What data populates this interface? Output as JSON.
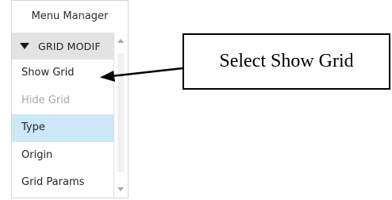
{
  "menu_manager": {
    "title": "Menu Manager",
    "group": {
      "label": "GRID MODIF",
      "expanded_icon": "triangle-down-icon"
    },
    "items": [
      {
        "label": "Show Grid",
        "state": "normal"
      },
      {
        "label": "Hide Grid",
        "state": "disabled"
      },
      {
        "label": "Type",
        "state": "selected"
      },
      {
        "label": "Origin",
        "state": "normal"
      },
      {
        "label": "Grid Params",
        "state": "normal"
      }
    ],
    "scrollbar": {
      "up_icon": "scroll-up-arrow-icon",
      "down_icon": "scroll-down-arrow-icon"
    }
  },
  "annotation": {
    "callout_text": "Select Show Grid",
    "arrow_icon": "pointer-arrow-icon"
  },
  "colors": {
    "selected_bg": "#cde8f7",
    "header_bg": "#e3e3e3",
    "disabled_text": "#a8a8a8"
  }
}
